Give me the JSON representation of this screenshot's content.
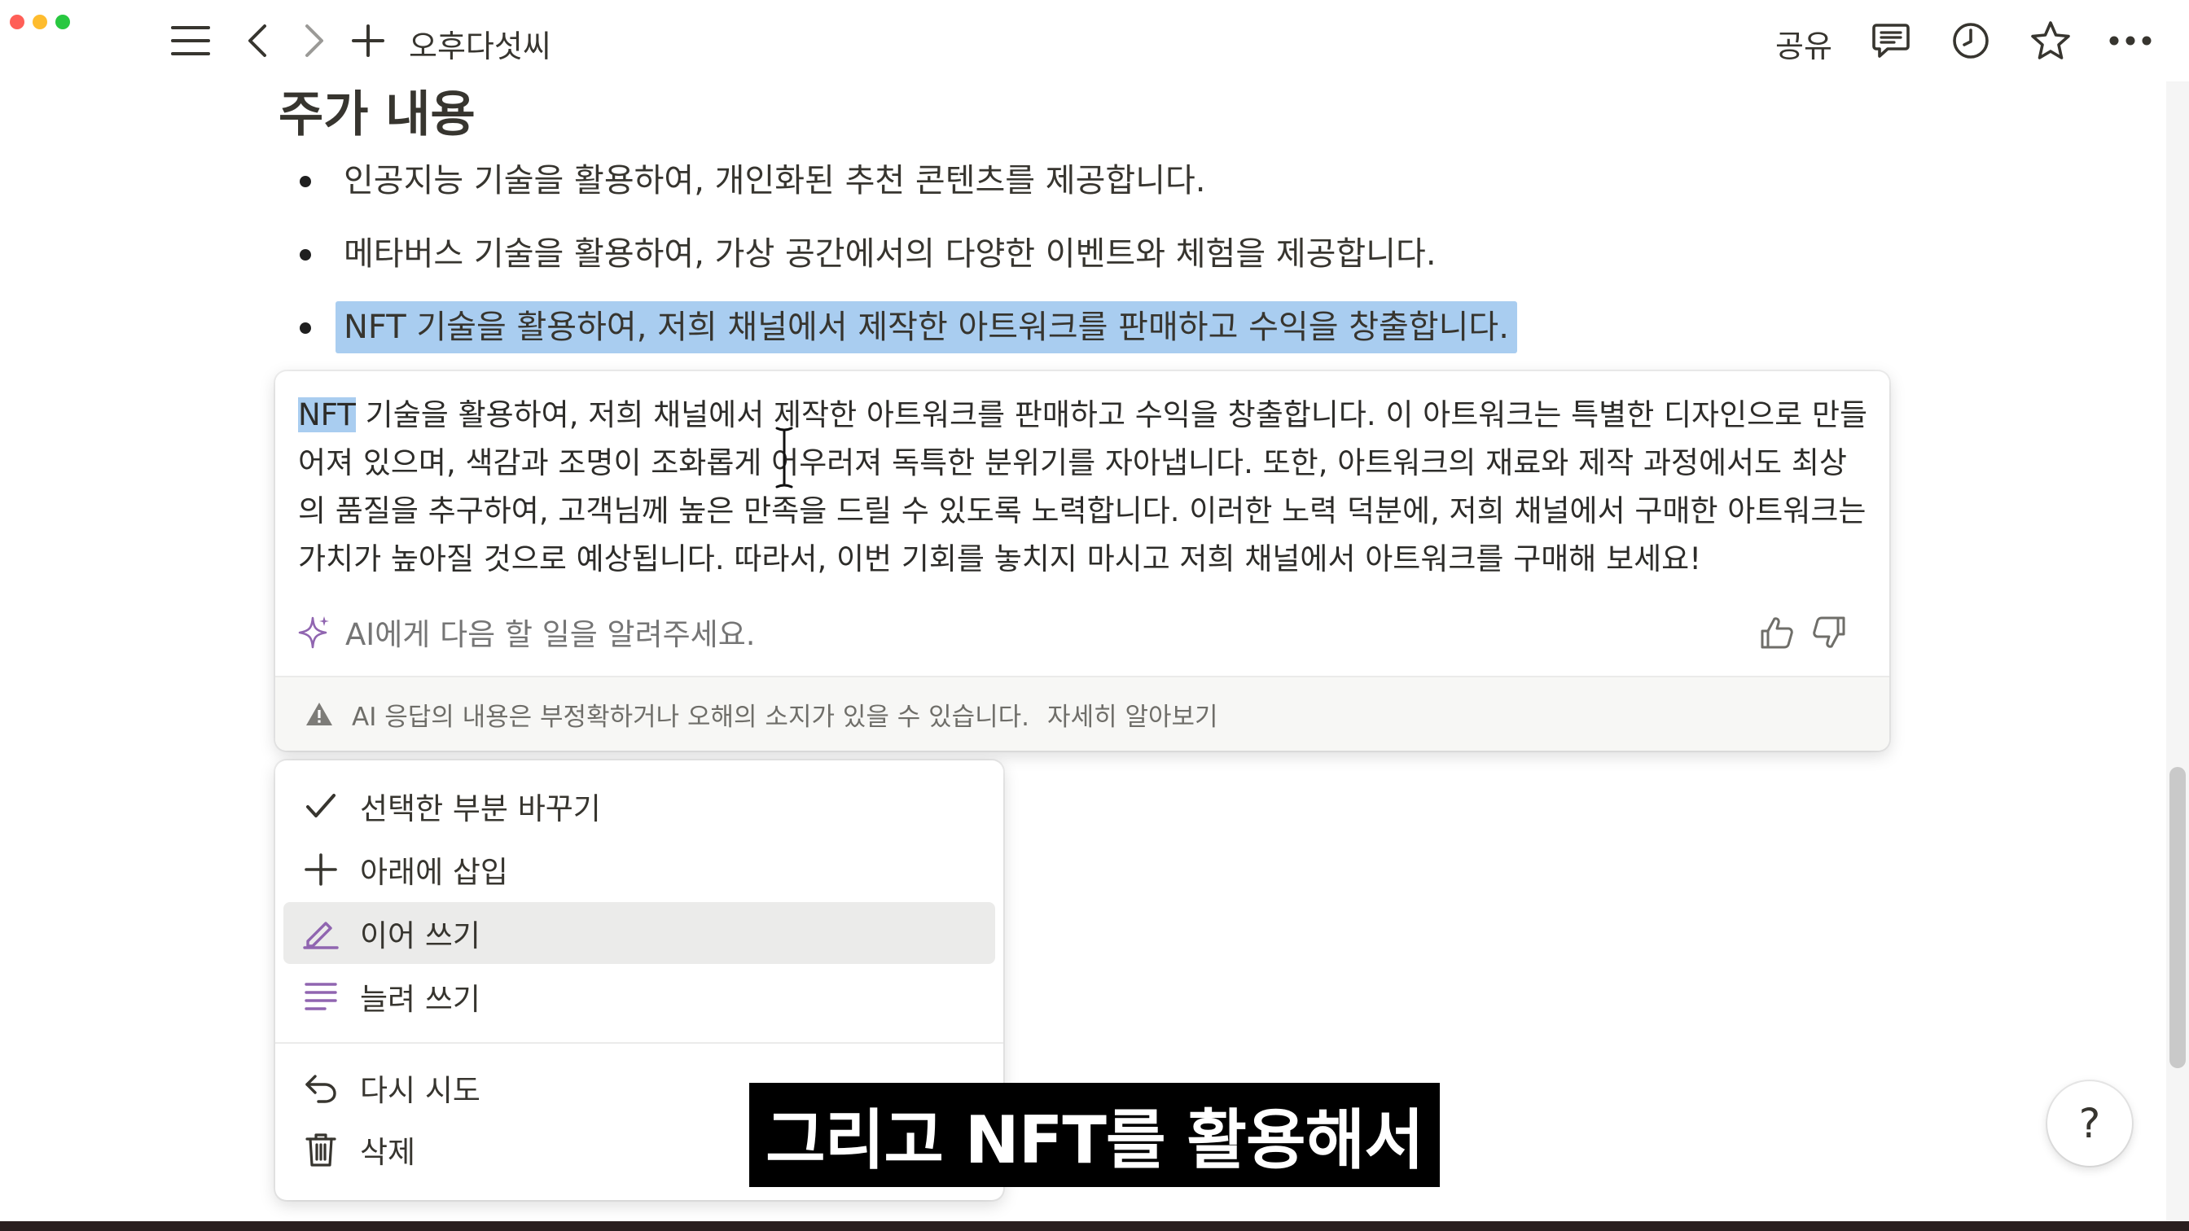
{
  "window": {
    "traffic": [
      "#ff5f57",
      "#febc2e",
      "#28c840"
    ]
  },
  "topbar": {
    "title": "오후다섯씨",
    "share_label": "공유"
  },
  "page": {
    "heading": "주가 내용",
    "bullets": [
      "인공지능 기술을 활용하여, 개인화된 추천 콘텐츠를 제공합니다.",
      "메타버스 기술을 활용하여, 가상 공간에서의 다양한 이벤트와 체험을 제공합니다.",
      "NFT 기술을 활용하여, 저희 채널에서 제작한 아트워크를 판매하고 수익을 창출합니다."
    ]
  },
  "ai_panel": {
    "response_highlight": "NFT",
    "response_rest": " 기술을 활용하여, 저희 채널에서 제작한 아트워크를 판매하고 수익을 창출합니다. 이 아트워크는 특별한 디자인으로 만들어져 있으며, 색감과 조명이 조화롭게 어우러져 독특한 분위기를 자아냅니다. 또한, 아트워크의 재료와 제작 과정에서도 최상의 품질을 추구하여, 고객님께 높은 만족을 드릴 수 있도록 노력합니다. 이러한 노력 덕분에, 저희 채널에서 구매한 아트워크는 가치가 높아질 것으로 예상됩니다. 따라서, 이번 기회를 놓치지 마시고 저희 채널에서 아트워크를 구매해 보세요!",
    "prompt_placeholder": "AI에게 다음 할 일을 알려주세요.",
    "disclaimer": "AI 응답의 내용은 부정확하거나 오해의 소지가 있을 수 있습니다.",
    "learn_more": "자세히 알아보기"
  },
  "menu": {
    "items": [
      {
        "label": "선택한 부분 바꾸기",
        "icon": "check-icon"
      },
      {
        "label": "아래에 삽입",
        "icon": "plus-icon"
      },
      {
        "label": "이어 쓰기",
        "icon": "pencil-icon",
        "active": true
      },
      {
        "label": "늘려 쓰기",
        "icon": "lines-icon"
      },
      {
        "label": "다시 시도",
        "icon": "undo-icon"
      },
      {
        "label": "삭제",
        "icon": "trash-icon"
      }
    ]
  },
  "caption": "그리고 NFT를 활용해서",
  "help_label": "?",
  "colors": {
    "accent_purple": "#9065b0",
    "selection": "#a9cdf0"
  }
}
